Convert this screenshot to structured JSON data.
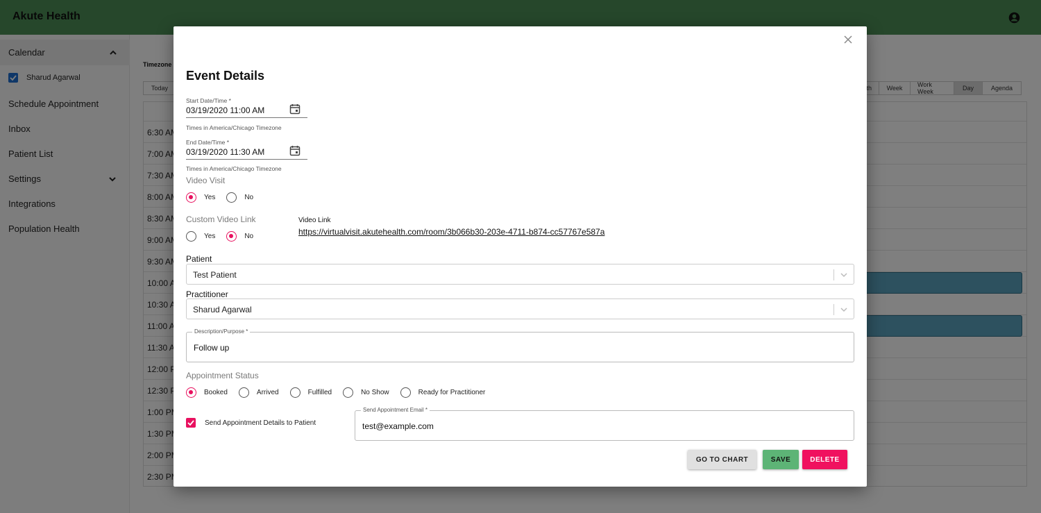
{
  "app": {
    "title": "Akute Health"
  },
  "sidebar": {
    "calendar_label": "Calendar",
    "calendar_user": "Sharud Agarwal",
    "items": [
      "Schedule Appointment",
      "Inbox",
      "Patient List",
      "Settings",
      "Integrations",
      "Population Health"
    ]
  },
  "calendar": {
    "timezone_label": "Timezone",
    "today_label": "Today",
    "views": [
      "th",
      "Week",
      "Work Week",
      "Day",
      "Agenda"
    ],
    "active_view": "Day",
    "times": [
      "6:30 AM",
      "7:00 AM",
      "7:30 AM",
      "8:00 AM",
      "8:30 AM",
      "9:00 AM",
      "9:30 AM",
      "10:00 AM",
      "10:30 AM",
      "11:00 AM",
      "11:30 AM",
      "12:00 PM",
      "12:30 PM",
      "1:00 PM",
      "1:30 PM",
      "2:00 PM",
      "2:30 PM"
    ]
  },
  "modal": {
    "title": "Event Details",
    "start": {
      "label": "Start Date/Time *",
      "value": "03/19/2020 11:00 AM",
      "helper": "Times in America/Chicago Timezone"
    },
    "end": {
      "label": "End Date/Time *",
      "value": "03/19/2020 11:30 AM",
      "helper": "Times in America/Chicago Timezone"
    },
    "video_visit": {
      "label": "Video Visit",
      "options": [
        "Yes",
        "No"
      ],
      "selected": "Yes"
    },
    "custom_video_link": {
      "label": "Custom Video Link",
      "options": [
        "Yes",
        "No"
      ],
      "selected": "No"
    },
    "video_link": {
      "label": "Video Link",
      "url": "https://virtualvisit.akutehealth.com/room/3b066b30-203e-4711-b874-cc57767e587a"
    },
    "patient": {
      "label": "Patient",
      "value": "Test Patient"
    },
    "practitioner": {
      "label": "Practitioner",
      "value": "Sharud Agarwal"
    },
    "description": {
      "label": "Description/Purpose *",
      "value": "Follow up"
    },
    "appointment_status": {
      "label": "Appointment Status",
      "options": [
        "Booked",
        "Arrived",
        "Fulfilled",
        "No Show",
        "Ready for Practitioner"
      ],
      "selected": "Booked"
    },
    "send_details": {
      "label": "Send Appointment Details to Patient",
      "checked": true
    },
    "send_email": {
      "label": "Send Appointment Email *",
      "value": "test@example.com"
    },
    "buttons": {
      "go_to_chart": "GO TO CHART",
      "save": "SAVE",
      "delete": "DELETE"
    }
  },
  "colors": {
    "header": "#4d8f57",
    "accent": "#e8115f",
    "save": "#5db476",
    "checkbox_blue": "#1e6fd0"
  },
  "icons": [
    "account-circle-icon",
    "chevron-up-icon",
    "chevron-down-icon",
    "close-icon",
    "calendar-icon",
    "checkbox-checked-icon"
  ]
}
